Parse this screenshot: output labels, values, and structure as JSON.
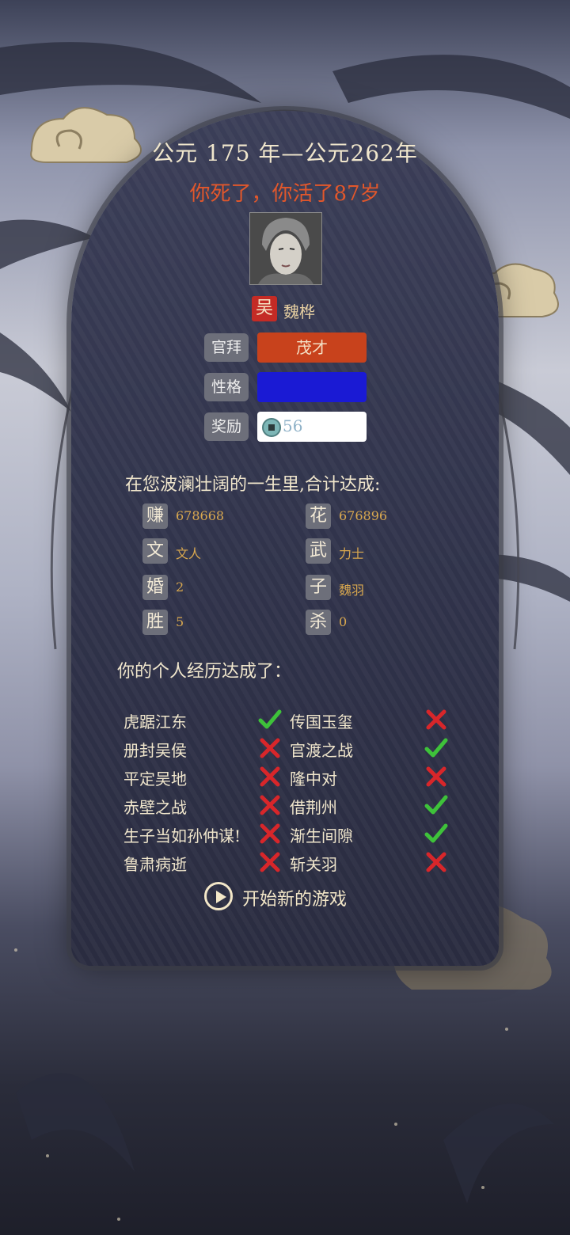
{
  "header": {
    "years": "公元 175 年—公元262年",
    "death_line": "你死了，你活了87岁"
  },
  "character": {
    "faction": "吴",
    "name": "魏桦",
    "portrait_icon": "helmeted-warrior-portrait"
  },
  "attributes": {
    "official_label": "官拜",
    "official_value": "茂才",
    "personality_label": "性格",
    "personality_value": "",
    "reward_label": "奖励",
    "reward_icon": "coin-icon",
    "reward_value": "56"
  },
  "achievements": {
    "title": "在您波澜壮阔的一生里,合计达成:",
    "stats": [
      {
        "char": "赚",
        "value": "678668"
      },
      {
        "char": "花",
        "value": "676896"
      },
      {
        "char": "文",
        "value": "文人"
      },
      {
        "char": "武",
        "value": "力士"
      },
      {
        "char": "婚",
        "value": "2"
      },
      {
        "char": "子",
        "value": "魏羽"
      },
      {
        "char": "胜",
        "value": "5"
      },
      {
        "char": "杀",
        "value": "0"
      }
    ]
  },
  "history": {
    "title": "你的个人经历达成了：",
    "items": [
      {
        "label": "虎踞江东",
        "done": true
      },
      {
        "label": "传国玉玺",
        "done": false
      },
      {
        "label": "册封吴侯",
        "done": false
      },
      {
        "label": "官渡之战",
        "done": true
      },
      {
        "label": "平定吴地",
        "done": false
      },
      {
        "label": "隆中对",
        "done": false
      },
      {
        "label": "赤壁之战",
        "done": false
      },
      {
        "label": "借荆州",
        "done": true
      },
      {
        "label": "生子当如孙仲谋!",
        "done": false
      },
      {
        "label": "渐生间隙",
        "done": true
      },
      {
        "label": "鲁肃病逝",
        "done": false
      },
      {
        "label": "斩关羽",
        "done": false
      }
    ]
  },
  "actions": {
    "new_game": "开始新的游戏"
  },
  "colors": {
    "official_bg": "#c8421c",
    "personality_bg": "#1a1ad4",
    "check": "#3ec23a",
    "cross": "#d8262a",
    "gold": "#d9a84f"
  }
}
